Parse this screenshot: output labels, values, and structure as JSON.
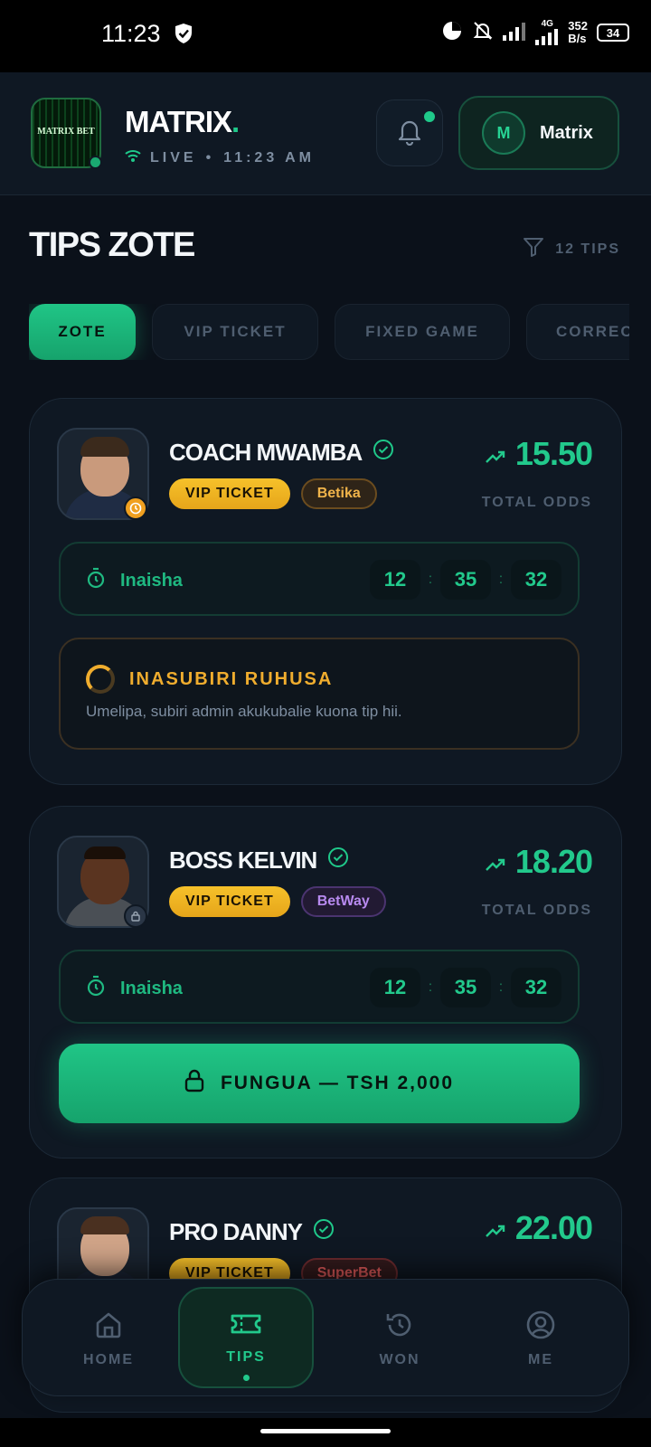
{
  "status_bar": {
    "time": "11:23",
    "network": "4G",
    "speed_value": "352",
    "speed_unit": "B/s",
    "battery": "34"
  },
  "header": {
    "logo_text": "MATRIX BET",
    "brand": "MATRIX",
    "brand_dot": ".",
    "live_label": "LIVE",
    "live_sep": "•",
    "live_time": "11:23 AM",
    "user_initial": "M",
    "user_name": "Matrix"
  },
  "page": {
    "title": "TIPS ZOTE",
    "tips_count": "12 TIPS"
  },
  "tabs": [
    {
      "label": "ZOTE",
      "active": true
    },
    {
      "label": "VIP TICKET",
      "active": false
    },
    {
      "label": "FIXED GAME",
      "active": false
    },
    {
      "label": "CORREC",
      "active": false
    }
  ],
  "cards": [
    {
      "name": "COACH MWAMBA",
      "category": "VIP TICKET",
      "bookmaker": "Betika",
      "odds": "15.50",
      "odds_label": "TOTAL ODDS",
      "countdown_label": "Inaisha",
      "countdown": {
        "h": "12",
        "m": "35",
        "s": "32"
      },
      "pending_title": "INASUBIRI RUHUSA",
      "pending_msg": "Umelipa, subiri admin akukubalie kuona tip hii."
    },
    {
      "name": "BOSS KELVIN",
      "category": "VIP TICKET",
      "bookmaker": "BetWay",
      "odds": "18.20",
      "odds_label": "TOTAL ODDS",
      "countdown_label": "Inaisha",
      "countdown": {
        "h": "12",
        "m": "35",
        "s": "32"
      },
      "unlock_label": "FUNGUA — TSH 2,000"
    },
    {
      "name": "PRO DANNY",
      "category": "VIP TICKET",
      "bookmaker": "SuperBet",
      "odds": "22.00"
    }
  ],
  "nav": [
    {
      "label": "HOME",
      "icon": "home-icon"
    },
    {
      "label": "TIPS",
      "icon": "ticket-icon"
    },
    {
      "label": "WON",
      "icon": "history-icon"
    },
    {
      "label": "ME",
      "icon": "user-icon"
    }
  ],
  "colors": {
    "accent": "#1fc98a",
    "vip": "#f6c12a",
    "background": "#0b111a",
    "card": "#0f1823"
  }
}
